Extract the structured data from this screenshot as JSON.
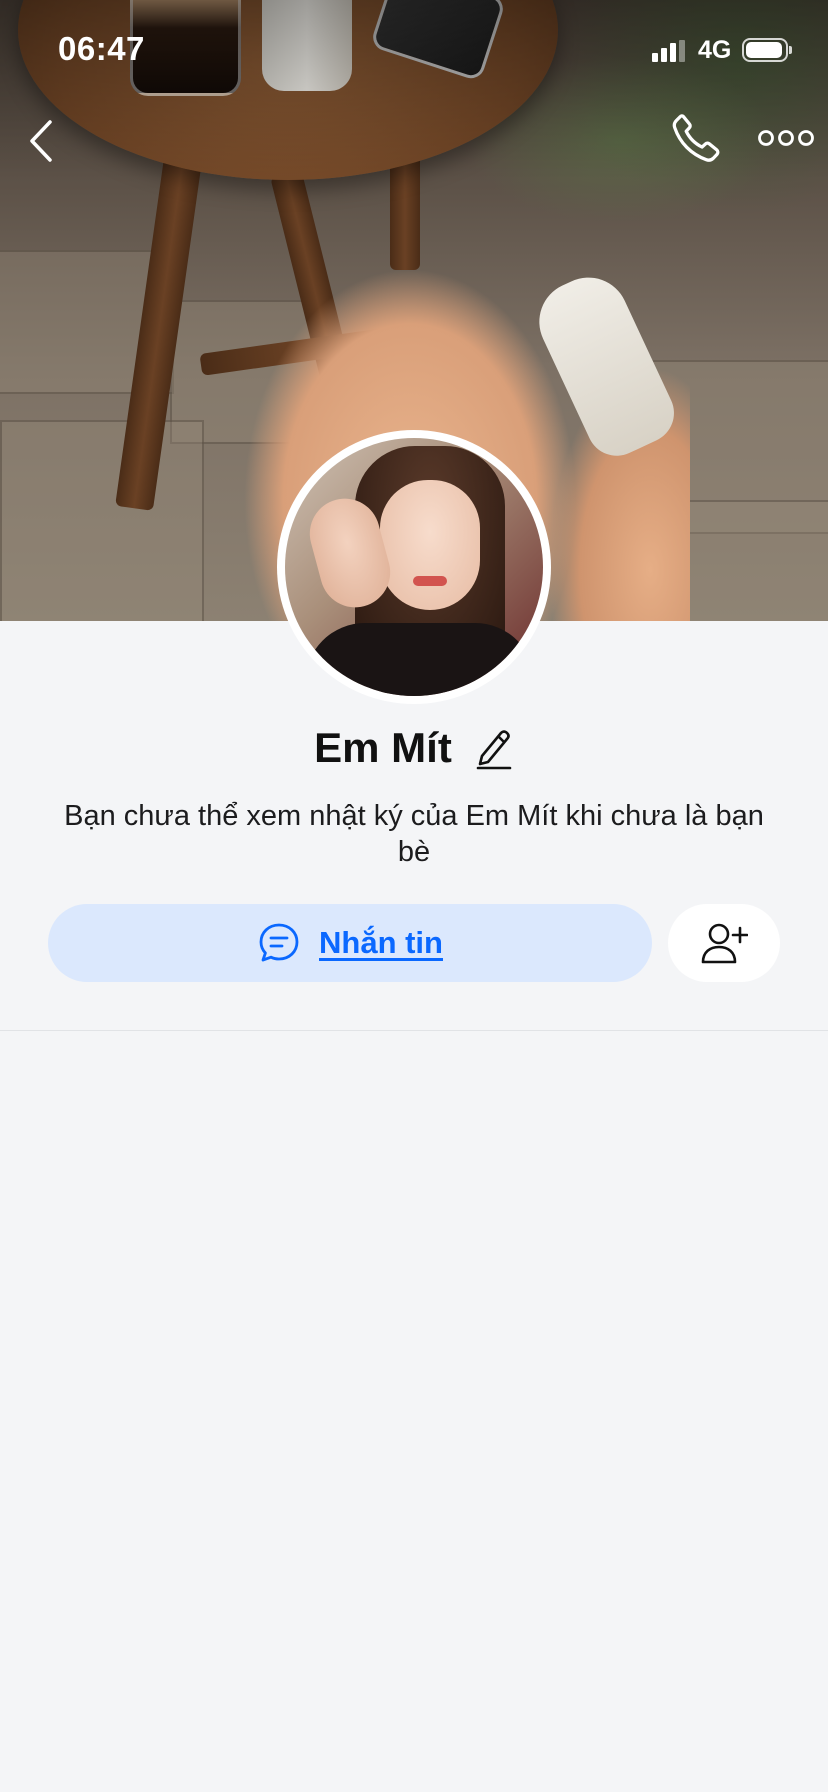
{
  "status_bar": {
    "time": "06:47",
    "network": "4G",
    "signal_bars": 3,
    "battery_level": 0.95
  },
  "header": {
    "back_icon": "chevron-left-icon",
    "call_icon": "phone-icon",
    "more_icon": "more-horizontal-icon"
  },
  "profile": {
    "name": "Em Mít",
    "edit_icon": "pencil-icon",
    "privacy_notice": "Bạn chưa thể xem nhật ký của Em Mít khi chưa là bạn bè"
  },
  "actions": {
    "message_label": "Nhắn tin",
    "message_icon": "chat-bubble-icon",
    "add_friend_icon": "add-user-icon"
  },
  "colors": {
    "accent": "#0a68ff",
    "message_button_bg": "#dbe8fd",
    "page_bg": "#f4f5f7"
  }
}
